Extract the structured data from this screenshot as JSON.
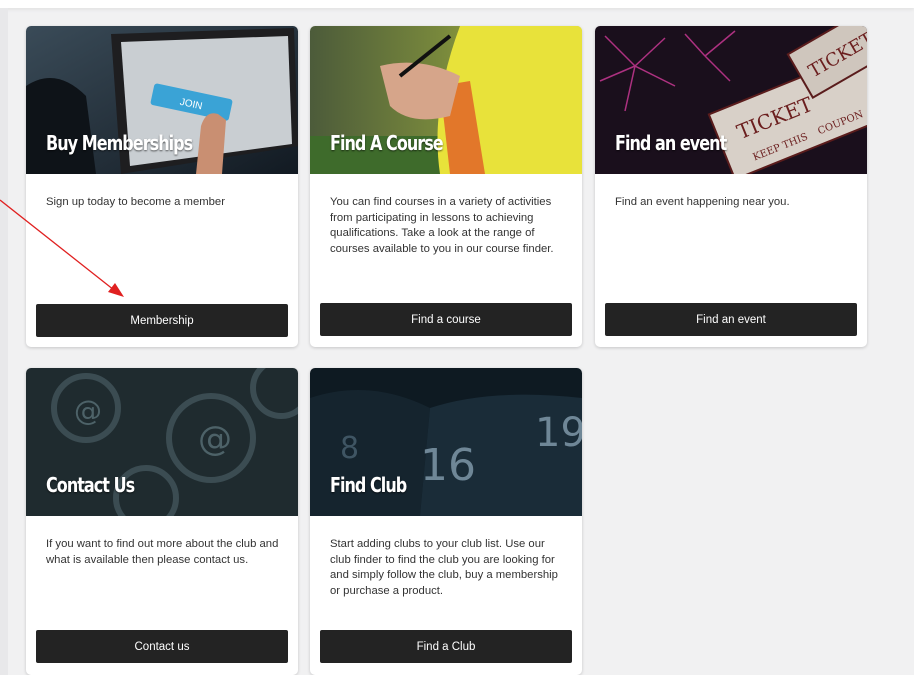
{
  "cards": [
    {
      "title": "Buy Memberships",
      "description": "Sign up today to become a member",
      "button": "Membership",
      "badge": "JOIN"
    },
    {
      "title": "Find A Course",
      "description": "You can find courses in a variety of activities from participating in lessons to achieving qualifications. Take a look at the range of courses available to you in our course finder.",
      "button": "Find a course"
    },
    {
      "title": "Find an event",
      "description": "Find an event happening near you.",
      "button": "Find an event",
      "ticket_words": [
        "TICKET",
        "TICKET",
        "KEEP THIS",
        "COUPON"
      ]
    },
    {
      "title": "Contact Us",
      "description": "If you want to find out more about the club and what is available then please contact us.",
      "button": "Contact us",
      "symbol": "@"
    },
    {
      "title": "Find Club",
      "description": "Start adding clubs to your club list. Use our club finder to find the club you are looking for and simply follow the club, buy a membership or purchase a product.",
      "button": "Find a Club",
      "jersey_numbers": [
        "16",
        "19",
        "8"
      ]
    }
  ],
  "colors": {
    "button_bg": "#232323",
    "page_bg": "#f1f1f2",
    "arrow": "#e02020"
  }
}
